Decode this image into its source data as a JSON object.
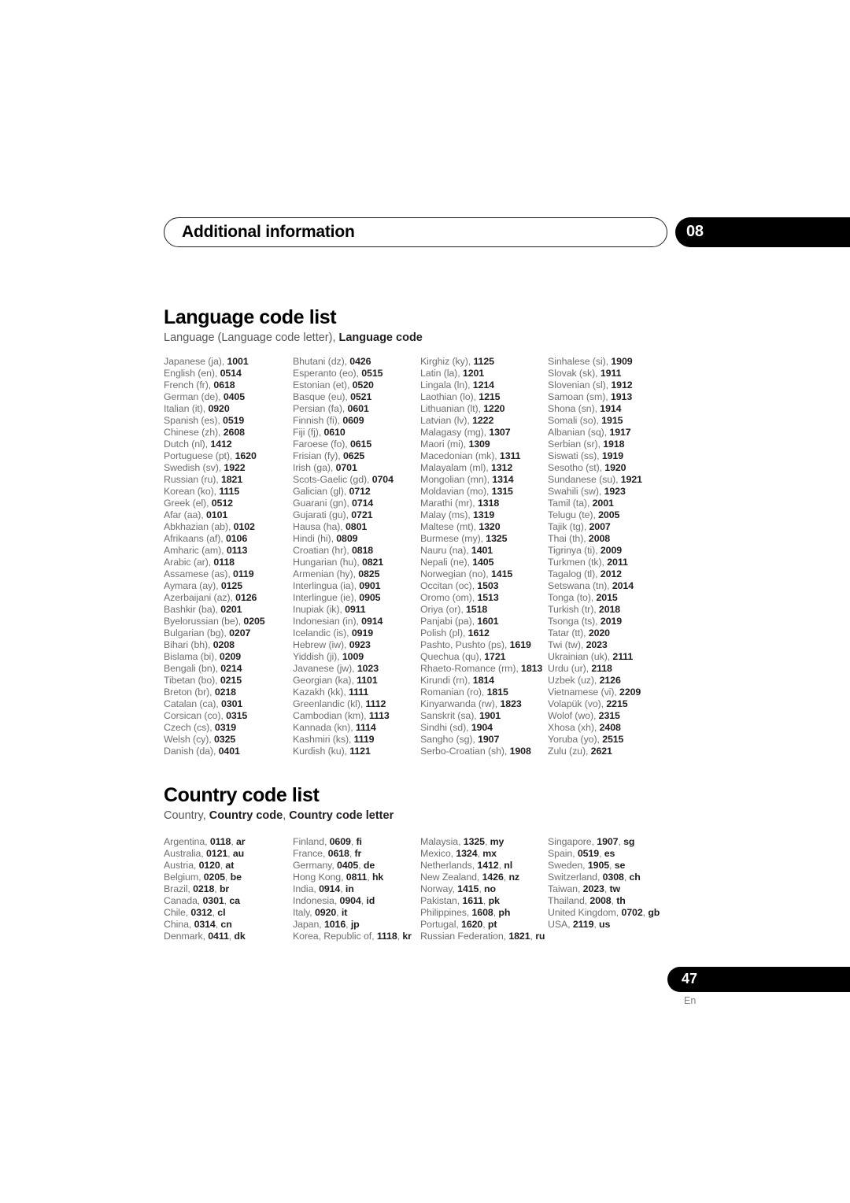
{
  "header": {
    "chapter_title": "Additional information",
    "chapter_number": "08"
  },
  "language_section": {
    "title": "Language code list",
    "legend_plain_1": "Language (Language code letter), ",
    "legend_bold_1": "Language code",
    "entries": [
      {
        "name": "Japanese (ja), ",
        "code": "1001"
      },
      {
        "name": "English (en), ",
        "code": "0514"
      },
      {
        "name": "French (fr), ",
        "code": "0618"
      },
      {
        "name": "German (de), ",
        "code": "0405"
      },
      {
        "name": "Italian (it), ",
        "code": "0920"
      },
      {
        "name": "Spanish (es), ",
        "code": "0519"
      },
      {
        "name": "Chinese (zh), ",
        "code": "2608"
      },
      {
        "name": "Dutch (nl), ",
        "code": "1412"
      },
      {
        "name": "Portuguese (pt), ",
        "code": "1620"
      },
      {
        "name": "Swedish (sv), ",
        "code": "1922"
      },
      {
        "name": "Russian (ru), ",
        "code": "1821"
      },
      {
        "name": "Korean (ko), ",
        "code": "1115"
      },
      {
        "name": "Greek (el), ",
        "code": "0512"
      },
      {
        "name": "Afar (aa), ",
        "code": "0101"
      },
      {
        "name": "Abkhazian (ab), ",
        "code": "0102"
      },
      {
        "name": "Afrikaans (af), ",
        "code": "0106"
      },
      {
        "name": "Amharic (am), ",
        "code": "0113"
      },
      {
        "name": "Arabic (ar), ",
        "code": "0118"
      },
      {
        "name": "Assamese (as), ",
        "code": "0119"
      },
      {
        "name": "Aymara (ay), ",
        "code": "0125"
      },
      {
        "name": "Azerbaijani (az), ",
        "code": "0126"
      },
      {
        "name": "Bashkir (ba), ",
        "code": "0201"
      },
      {
        "name": "Byelorussian (be), ",
        "code": "0205"
      },
      {
        "name": "Bulgarian (bg), ",
        "code": "0207"
      },
      {
        "name": "Bihari (bh), ",
        "code": "0208"
      },
      {
        "name": "Bislama (bi), ",
        "code": "0209"
      },
      {
        "name": "Bengali (bn), ",
        "code": "0214"
      },
      {
        "name": "Tibetan (bo), ",
        "code": "0215"
      },
      {
        "name": "Breton (br), ",
        "code": "0218"
      },
      {
        "name": "Catalan (ca), ",
        "code": "0301"
      },
      {
        "name": "Corsican (co), ",
        "code": "0315"
      },
      {
        "name": "Czech (cs), ",
        "code": "0319"
      },
      {
        "name": "Welsh (cy), ",
        "code": "0325"
      },
      {
        "name": "Danish (da), ",
        "code": "0401"
      },
      {
        "name": "Bhutani (dz), ",
        "code": "0426"
      },
      {
        "name": "Esperanto (eo), ",
        "code": "0515"
      },
      {
        "name": "Estonian (et), ",
        "code": "0520"
      },
      {
        "name": "Basque (eu), ",
        "code": "0521"
      },
      {
        "name": "Persian (fa), ",
        "code": "0601"
      },
      {
        "name": "Finnish (fi), ",
        "code": "0609"
      },
      {
        "name": "Fiji (fj), ",
        "code": "0610"
      },
      {
        "name": "Faroese (fo), ",
        "code": "0615"
      },
      {
        "name": "Frisian (fy), ",
        "code": "0625"
      },
      {
        "name": "Irish (ga), ",
        "code": "0701"
      },
      {
        "name": "Scots-Gaelic (gd), ",
        "code": "0704"
      },
      {
        "name": "Galician (gl), ",
        "code": "0712"
      },
      {
        "name": "Guarani (gn), ",
        "code": "0714"
      },
      {
        "name": "Gujarati (gu), ",
        "code": "0721"
      },
      {
        "name": "Hausa (ha), ",
        "code": "0801"
      },
      {
        "name": "Hindi (hi), ",
        "code": "0809"
      },
      {
        "name": "Croatian (hr), ",
        "code": "0818"
      },
      {
        "name": "Hungarian (hu), ",
        "code": "0821"
      },
      {
        "name": "Armenian (hy), ",
        "code": "0825"
      },
      {
        "name": "Interlingua (ia), ",
        "code": "0901"
      },
      {
        "name": "Interlingue (ie), ",
        "code": "0905"
      },
      {
        "name": "Inupiak (ik), ",
        "code": "0911"
      },
      {
        "name": "Indonesian (in), ",
        "code": "0914"
      },
      {
        "name": "Icelandic (is), ",
        "code": "0919"
      },
      {
        "name": "Hebrew (iw), ",
        "code": "0923"
      },
      {
        "name": "Yiddish (ji), ",
        "code": "1009"
      },
      {
        "name": "Javanese (jw), ",
        "code": "1023"
      },
      {
        "name": "Georgian (ka), ",
        "code": "1101"
      },
      {
        "name": "Kazakh (kk), ",
        "code": "1111"
      },
      {
        "name": "Greenlandic  (kl), ",
        "code": "1112"
      },
      {
        "name": "Cambodian (km), ",
        "code": "1113"
      },
      {
        "name": "Kannada (kn), ",
        "code": "1114"
      },
      {
        "name": "Kashmiri (ks), ",
        "code": "1119"
      },
      {
        "name": "Kurdish (ku), ",
        "code": "1121"
      },
      {
        "name": "Kirghiz (ky), ",
        "code": "1125"
      },
      {
        "name": "Latin (la), ",
        "code": "1201"
      },
      {
        "name": "Lingala (ln), ",
        "code": "1214"
      },
      {
        "name": "Laothian (lo), ",
        "code": "1215"
      },
      {
        "name": "Lithuanian (lt), ",
        "code": "1220"
      },
      {
        "name": "Latvian (lv), ",
        "code": "1222"
      },
      {
        "name": "Malagasy (mg), ",
        "code": "1307"
      },
      {
        "name": "Maori (mi), ",
        "code": "1309"
      },
      {
        "name": "Macedonian (mk), ",
        "code": "1311"
      },
      {
        "name": "Malayalam  (ml), ",
        "code": "1312"
      },
      {
        "name": "Mongolian (mn), ",
        "code": "1314"
      },
      {
        "name": "Moldavian (mo), ",
        "code": "1315"
      },
      {
        "name": "Marathi (mr), ",
        "code": "1318"
      },
      {
        "name": "Malay  (ms), ",
        "code": "1319"
      },
      {
        "name": "Maltese (mt), ",
        "code": "1320"
      },
      {
        "name": "Burmese (my), ",
        "code": "1325"
      },
      {
        "name": "Nauru (na), ",
        "code": "1401"
      },
      {
        "name": "Nepali (ne), ",
        "code": "1405"
      },
      {
        "name": "Norwegian (no), ",
        "code": "1415"
      },
      {
        "name": "Occitan (oc), ",
        "code": "1503"
      },
      {
        "name": "Oromo (om), ",
        "code": "1513"
      },
      {
        "name": "Oriya (or), ",
        "code": "1518"
      },
      {
        "name": "Panjabi (pa), ",
        "code": "1601"
      },
      {
        "name": "Polish (pl), ",
        "code": "1612"
      },
      {
        "name": "Pashto, Pushto (ps), ",
        "code": "1619"
      },
      {
        "name": "Quechua (qu), ",
        "code": "1721"
      },
      {
        "name": "Rhaeto-Romance (rm), ",
        "code": "1813"
      },
      {
        "name": "Kirundi (rn), ",
        "code": "1814"
      },
      {
        "name": "Romanian (ro), ",
        "code": "1815"
      },
      {
        "name": "Kinyarwanda (rw), ",
        "code": "1823"
      },
      {
        "name": "Sanskrit (sa), ",
        "code": "1901"
      },
      {
        "name": "Sindhi (sd), ",
        "code": "1904"
      },
      {
        "name": "Sangho (sg), ",
        "code": "1907"
      },
      {
        "name": "Serbo-Croatian (sh), ",
        "code": "1908"
      },
      {
        "name": "Sinhalese (si), ",
        "code": "1909"
      },
      {
        "name": "Slovak (sk), ",
        "code": "1911"
      },
      {
        "name": "Slovenian (sl), ",
        "code": "1912"
      },
      {
        "name": "Samoan (sm), ",
        "code": "1913"
      },
      {
        "name": "Shona (sn), ",
        "code": "1914"
      },
      {
        "name": "Somali (so), ",
        "code": "1915"
      },
      {
        "name": "Albanian (sq), ",
        "code": "1917"
      },
      {
        "name": "Serbian (sr), ",
        "code": "1918"
      },
      {
        "name": "Siswati (ss), ",
        "code": "1919"
      },
      {
        "name": "Sesotho (st), ",
        "code": "1920"
      },
      {
        "name": "Sundanese (su), ",
        "code": "1921"
      },
      {
        "name": "Swahili (sw), ",
        "code": "1923"
      },
      {
        "name": "Tamil (ta), ",
        "code": "2001"
      },
      {
        "name": "Telugu (te), ",
        "code": "2005"
      },
      {
        "name": "Tajik (tg), ",
        "code": "2007"
      },
      {
        "name": "Thai (th), ",
        "code": "2008"
      },
      {
        "name": "Tigrinya (ti), ",
        "code": "2009"
      },
      {
        "name": "Turkmen (tk), ",
        "code": "2011"
      },
      {
        "name": "Tagalog (tl), ",
        "code": "2012"
      },
      {
        "name": "Setswana (tn), ",
        "code": "2014"
      },
      {
        "name": "Tonga (to), ",
        "code": "2015"
      },
      {
        "name": "Turkish (tr), ",
        "code": "2018"
      },
      {
        "name": "Tsonga (ts), ",
        "code": "2019"
      },
      {
        "name": "Tatar (tt), ",
        "code": "2020"
      },
      {
        "name": "Twi (tw), ",
        "code": "2023"
      },
      {
        "name": "Ukrainian (uk), ",
        "code": "2111"
      },
      {
        "name": "Urdu (ur), ",
        "code": "2118"
      },
      {
        "name": "Uzbek (uz), ",
        "code": "2126"
      },
      {
        "name": "Vietnamese (vi), ",
        "code": "2209"
      },
      {
        "name": "Volapük (vo), ",
        "code": "2215"
      },
      {
        "name": "Wolof (wo), ",
        "code": "2315"
      },
      {
        "name": "Xhosa (xh), ",
        "code": "2408"
      },
      {
        "name": "Yoruba (yo), ",
        "code": "2515"
      },
      {
        "name": "Zulu (zu), ",
        "code": "2621"
      }
    ]
  },
  "country_section": {
    "title": "Country code list",
    "legend_plain_1": "Country, ",
    "legend_bold_1": "Country code",
    "legend_plain_2": ", ",
    "legend_bold_2": "Country code letter",
    "entries": [
      {
        "name": "Argentina, ",
        "code": "0118",
        "sep": ", ",
        "letter": "ar"
      },
      {
        "name": "Australia, ",
        "code": "0121",
        "sep": ", ",
        "letter": "au"
      },
      {
        "name": "Austria, ",
        "code": "0120",
        "sep": ", ",
        "letter": "at"
      },
      {
        "name": "Belgium, ",
        "code": "0205",
        "sep": ", ",
        "letter": "be"
      },
      {
        "name": "Brazil, ",
        "code": "0218",
        "sep": ", ",
        "letter": "br"
      },
      {
        "name": "Canada, ",
        "code": "0301",
        "sep": ", ",
        "letter": "ca"
      },
      {
        "name": "Chile, ",
        "code": "0312",
        "sep": ", ",
        "letter": "cl"
      },
      {
        "name": "China, ",
        "code": "0314",
        "sep": ", ",
        "letter": "cn"
      },
      {
        "name": "Denmark, ",
        "code": "0411",
        "sep": ", ",
        "letter": "dk"
      },
      {
        "name": "Finland, ",
        "code": "0609",
        "sep": ", ",
        "letter": "fi"
      },
      {
        "name": "France, ",
        "code": "0618",
        "sep": ", ",
        "letter": "fr"
      },
      {
        "name": "Germany, ",
        "code": "0405",
        "sep": ", ",
        "letter": "de"
      },
      {
        "name": "Hong Kong, ",
        "code": "0811",
        "sep": ", ",
        "letter": "hk"
      },
      {
        "name": "India, ",
        "code": "0914",
        "sep": ", ",
        "letter": "in"
      },
      {
        "name": "Indonesia, ",
        "code": "0904",
        "sep": ", ",
        "letter": "id"
      },
      {
        "name": "Italy, ",
        "code": "0920",
        "sep": ", ",
        "letter": "it"
      },
      {
        "name": "Japan, ",
        "code": "1016",
        "sep": ", ",
        "letter": "jp"
      },
      {
        "name": "Korea, Republic of, ",
        "code": "1118",
        "sep": ", ",
        "letter": "kr"
      },
      {
        "name": "Malaysia, ",
        "code": "1325",
        "sep": ", ",
        "letter": "my"
      },
      {
        "name": "Mexico, ",
        "code": "1324",
        "sep": ", ",
        "letter": "mx"
      },
      {
        "name": "Netherlands, ",
        "code": "1412",
        "sep": ", ",
        "letter": "nl"
      },
      {
        "name": "New Zealand, ",
        "code": "1426",
        "sep": ", ",
        "letter": "nz"
      },
      {
        "name": "Norway, ",
        "code": "1415",
        "sep": ", ",
        "letter": "no"
      },
      {
        "name": "Pakistan, ",
        "code": "1611",
        "sep": ", ",
        "letter": "pk"
      },
      {
        "name": "Philippines, ",
        "code": "1608",
        "sep": ", ",
        "letter": "ph"
      },
      {
        "name": "Portugal, ",
        "code": "1620",
        "sep": ", ",
        "letter": "pt"
      },
      {
        "name": "Russian Federation, ",
        "code": "1821",
        "sep": ", ",
        "letter": "ru"
      },
      {
        "name": "Singapore, ",
        "code": "1907",
        "sep": ", ",
        "letter": "sg"
      },
      {
        "name": "Spain, ",
        "code": "0519",
        "sep": ", ",
        "letter": "es"
      },
      {
        "name": "Sweden, ",
        "code": "1905",
        "sep": ", ",
        "letter": "se"
      },
      {
        "name": "Switzerland, ",
        "code": "0308",
        "sep": ", ",
        "letter": "ch"
      },
      {
        "name": "Taiwan, ",
        "code": "2023",
        "sep": ", ",
        "letter": "tw"
      },
      {
        "name": "Thailand, ",
        "code": "2008",
        "sep": ", ",
        "letter": "th"
      },
      {
        "name": "United Kingdom, ",
        "code": "0702",
        "sep": ", ",
        "letter": "gb"
      },
      {
        "name": "USA, ",
        "code": "2119",
        "sep": ", ",
        "letter": "us"
      },
      {
        "name": "",
        "code": "",
        "sep": "",
        "letter": ""
      }
    ]
  },
  "footer": {
    "page_number": "47",
    "locale": "En"
  },
  "colors": {
    "ink": "#231f20",
    "muted": "#6d6e71",
    "badge": "#000000"
  }
}
